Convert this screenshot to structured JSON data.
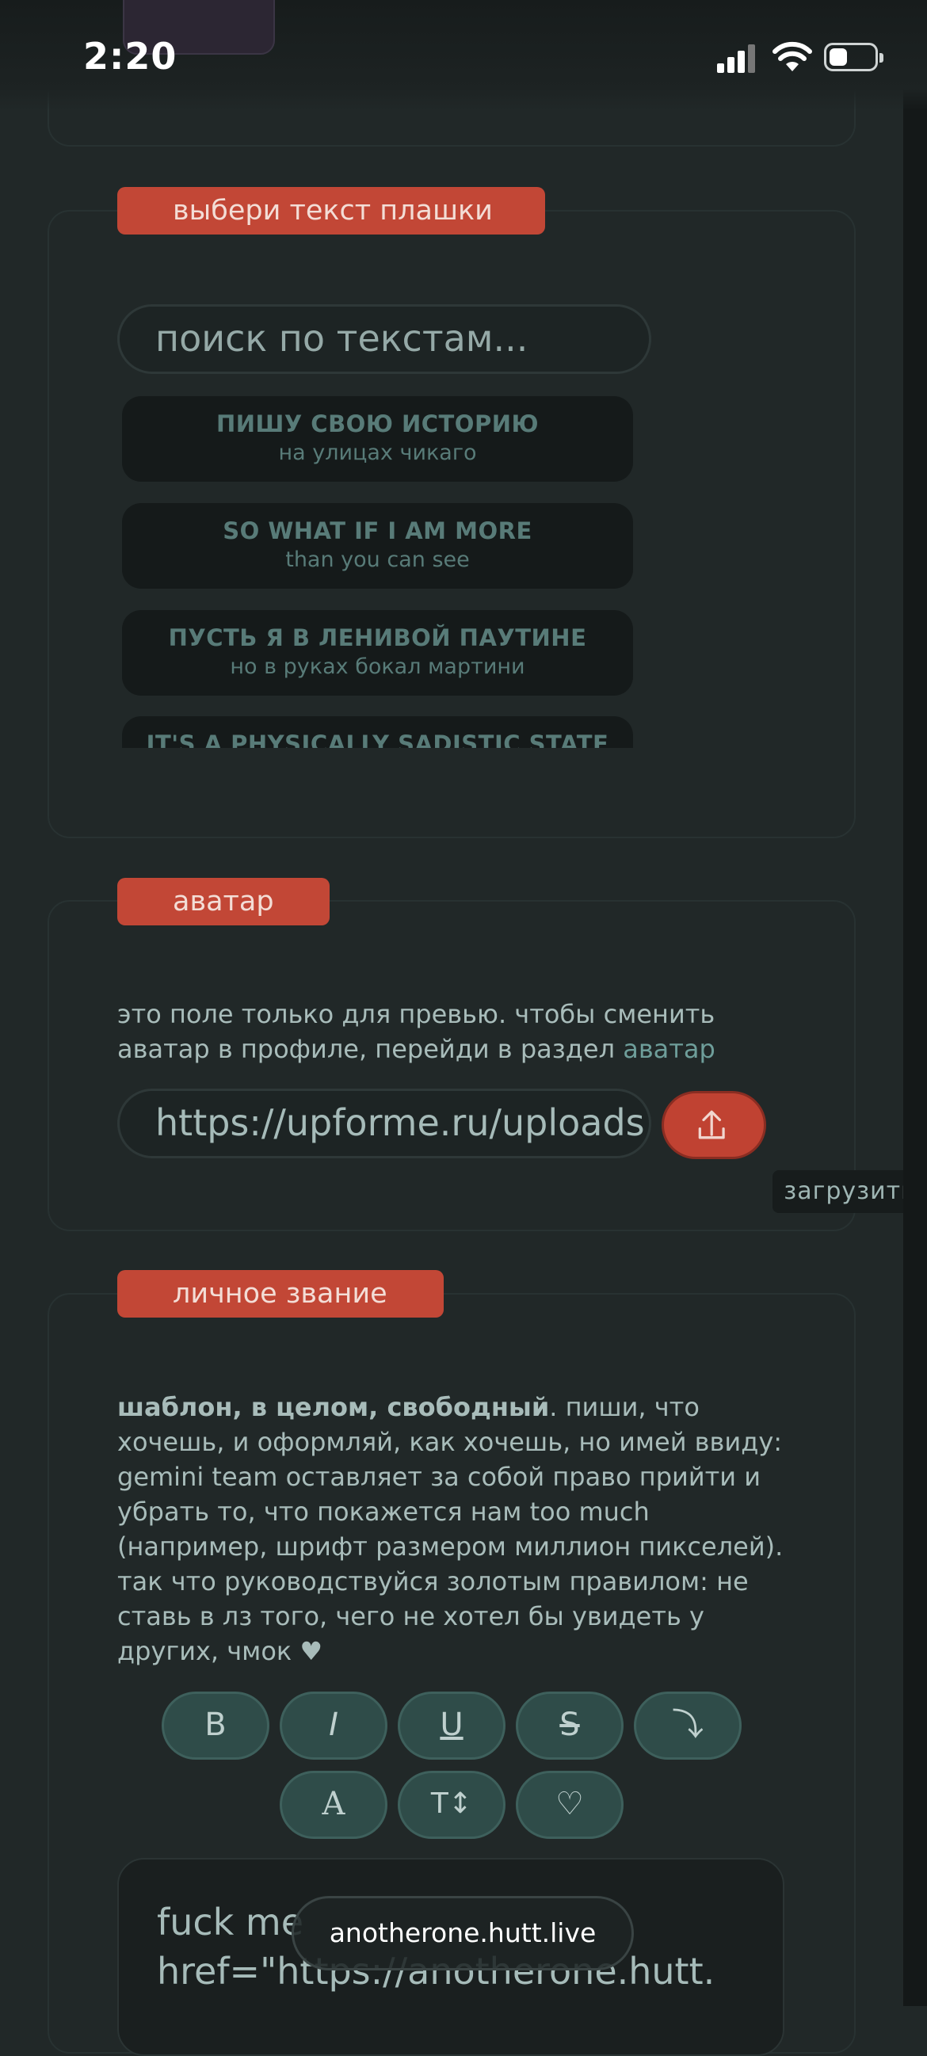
{
  "status_bar": {
    "time": "2:20"
  },
  "section_text": {
    "label": "выбери текст плашки",
    "search_placeholder": "поиск по текстам...",
    "items": [
      {
        "title": "ПИШУ СВОЮ ИСТОРИЮ",
        "subtitle": "на улицах чикаго"
      },
      {
        "title": "SO WHAT IF I AM MORE",
        "subtitle": "than you can see"
      },
      {
        "title": "ПУСТЬ Я В ЛЕНИВОЙ ПАУТИНЕ",
        "subtitle": "но в руках бокал мартини"
      },
      {
        "title": "IT'S A PHYSICALLY SADISTIC STATE",
        "subtitle": ""
      }
    ]
  },
  "section_avatar": {
    "label": "аватар",
    "note": "это поле только для превью. чтобы сменить аватар в профиле, перейди в раздел",
    "note_link": "аватар",
    "url_value": "https://upforme.ru/uploads",
    "upload_tooltip": "загрузить"
  },
  "section_title": {
    "label": "личное звание",
    "desc_bold": "шаблон, в целом, свободный",
    "desc_rest": ". пиши, что хочешь, и оформляй, как хочешь, но имей ввиду: gemini team оставляет за собой право прийти и убрать то, что покажется нам too much (например, шрифт размером миллион пикселей). так что руководствуйся золотым правилом: не ставь в лз того, чего не хотел бы увидеть у других, чмок ♥",
    "toolbar": [
      "B",
      "I",
      "U",
      "S",
      "⤵",
      "A",
      "T↕",
      "♡"
    ],
    "editor_line1": "fuck me",
    "editor_line2": "href=\"https://anotherone.hutt."
  },
  "browser": {
    "url": "anotherone.hutt.live"
  }
}
